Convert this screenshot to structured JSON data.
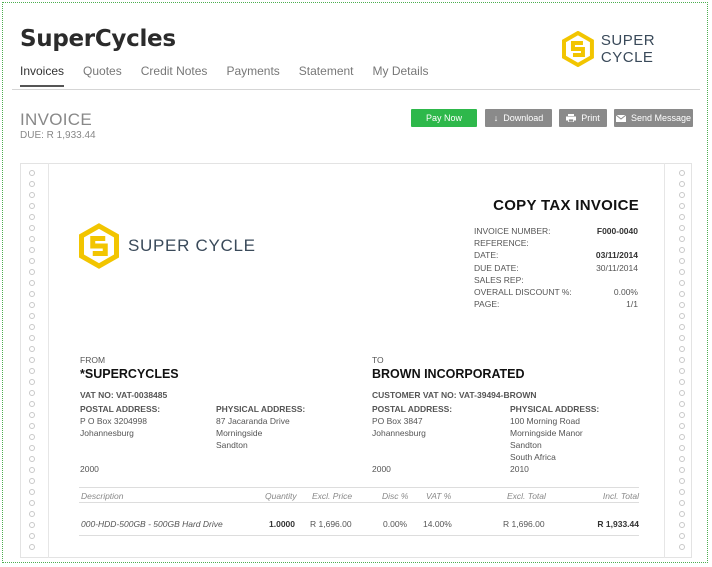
{
  "app": {
    "brand": "SuperCycles",
    "logo_text": "SUPER CYCLE"
  },
  "nav": {
    "tabs": [
      "Invoices",
      "Quotes",
      "Credit Notes",
      "Payments",
      "Statement",
      "My Details"
    ],
    "active": 0
  },
  "header": {
    "title": "INVOICE",
    "due": "DUE: R 1,933.44"
  },
  "actions": {
    "pay": "Pay Now",
    "download": "Download",
    "print": "Print",
    "message": "Send Message"
  },
  "invoice": {
    "heading": "COPY TAX INVOICE",
    "meta": [
      {
        "label": "INVOICE NUMBER:",
        "value": "F000-0040"
      },
      {
        "label": "REFERENCE:",
        "value": ""
      },
      {
        "label": "DATE:",
        "value": "03/11/2014"
      },
      {
        "label": "DUE DATE:",
        "value": "30/11/2014"
      },
      {
        "label": "SALES REP:",
        "value": ""
      },
      {
        "label": "OVERALL DISCOUNT %:",
        "value": "0.00%"
      },
      {
        "label": "PAGE:",
        "value": "1/1"
      }
    ],
    "from": {
      "label": "FROM",
      "name": "*SUPERCYCLES",
      "vat": "VAT NO:  VAT-0038485",
      "postal_label": "POSTAL ADDRESS:",
      "postal": [
        "P O Box 3204998",
        "Johannesburg",
        "",
        "2000"
      ],
      "physical_label": "PHYSICAL ADDRESS:",
      "physical": [
        "87 Jacaranda Drive",
        "Morningside",
        "Sandton"
      ]
    },
    "to": {
      "label": "TO",
      "name": "BROWN INCORPORATED",
      "vat": "CUSTOMER VAT NO:  VAT-39494-BROWN",
      "postal_label": "POSTAL ADDRESS:",
      "postal": [
        "PO Box 3847",
        "Johannesburg",
        "",
        "2000"
      ],
      "physical_label": "PHYSICAL ADDRESS:",
      "physical": [
        "100 Morning Road",
        "Morningside Manor",
        "Sandton",
        "South Africa",
        "2010"
      ]
    },
    "table": {
      "headers": {
        "desc": "Description",
        "qty": "Quantity",
        "price": "Excl. Price",
        "disc": "Disc %",
        "vat": "VAT %",
        "excl": "Excl. Total",
        "incl": "Incl. Total"
      },
      "rows": [
        {
          "desc": "000-HDD-500GB - 500GB Hard Drive",
          "qty": "1.0000",
          "price": "R 1,696.00",
          "disc": "0.00%",
          "vat": "14.00%",
          "excl": "R 1,696.00",
          "incl": "R 1,933.44"
        }
      ]
    }
  },
  "colors": {
    "pay": "#2eb84b",
    "secondary_button": "#8a8a8a",
    "logo_yellow": "#f2c500",
    "logo_text": "#3a4a5a"
  }
}
